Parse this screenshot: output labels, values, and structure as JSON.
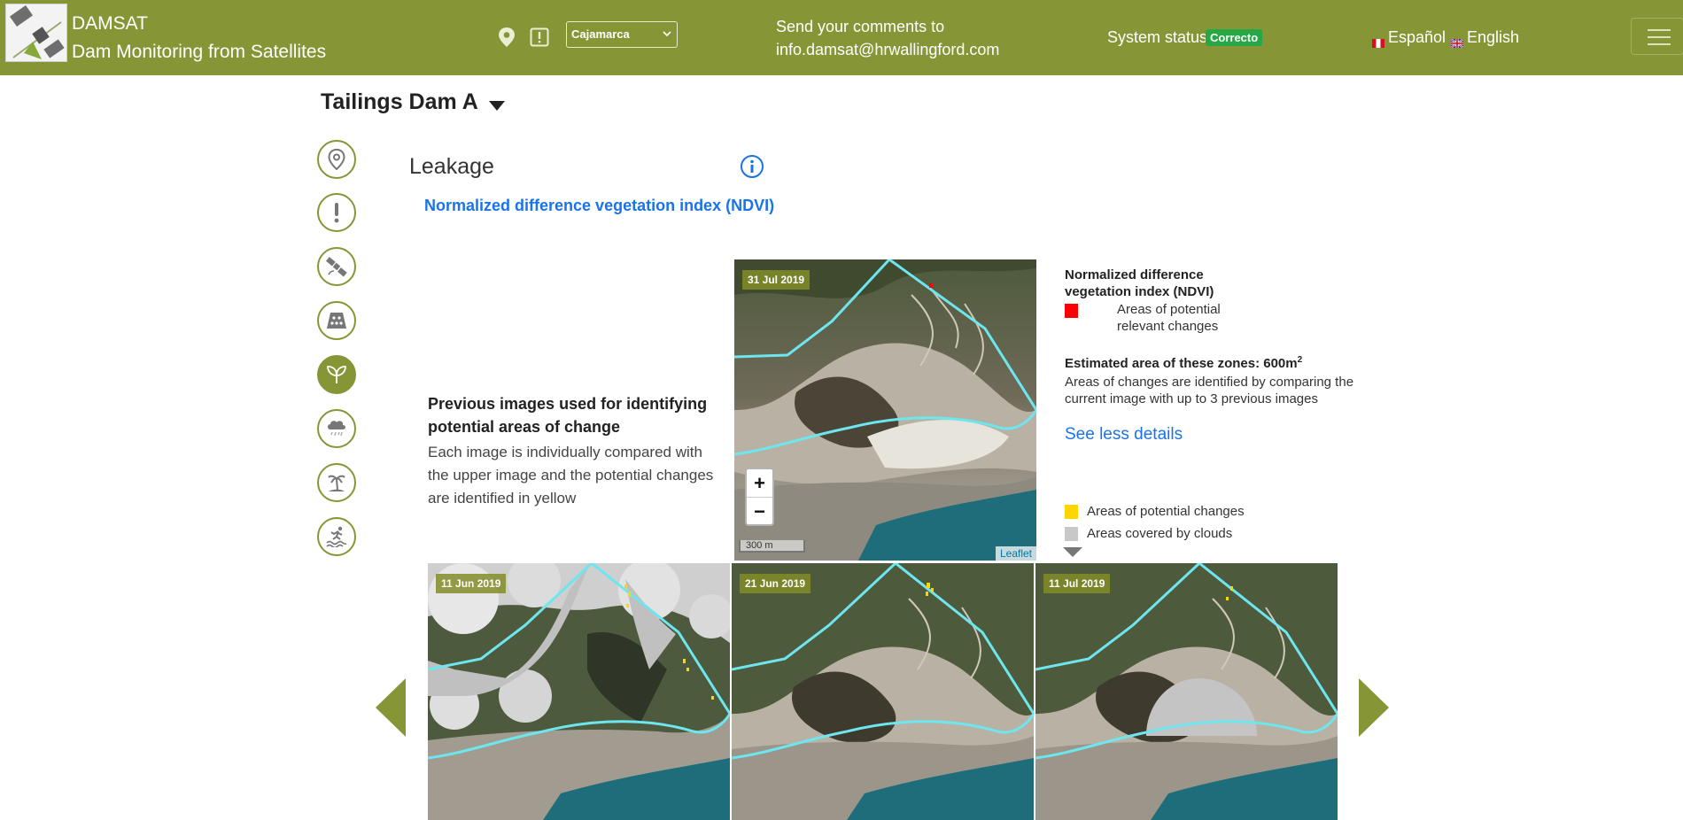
{
  "header": {
    "app_name": "DAMSAT",
    "app_subtitle": "Dam Monitoring from Satellites",
    "region": "Cajamarca",
    "comments_line1": "Send your comments to",
    "comments_email": "info.damsat@hrwallingford.com",
    "status_label": "System status",
    "status_value": "Correcto",
    "lang_es": "Español",
    "lang_en": "English"
  },
  "dam": {
    "title": "Tailings Dam A"
  },
  "sidebar": {
    "items": [
      {
        "icon": "location-pin-icon"
      },
      {
        "icon": "alert-icon"
      },
      {
        "icon": "satellite-icon"
      },
      {
        "icon": "dam-structure-icon"
      },
      {
        "icon": "leaf-icon",
        "active": true
      },
      {
        "icon": "rain-cloud-icon"
      },
      {
        "icon": "palm-tree-icon"
      },
      {
        "icon": "flood-runner-icon"
      }
    ]
  },
  "content": {
    "section_title": "Leakage",
    "index_link": "Normalized difference vegetation index (NDVI)",
    "prev_title": "Previous images used for identifying potential areas of change",
    "prev_desc": "Each image is individually compared with the upper image and the potential changes are identified in yellow",
    "main_map": {
      "date": "31 Jul 2019",
      "zoom_in": "+",
      "zoom_out": "−",
      "scale": "300 m",
      "attribution": "Leaflet"
    },
    "thumbnails": [
      {
        "date": "11 Jun 2019"
      },
      {
        "date": "21 Jun 2019"
      },
      {
        "date": "11 Jul 2019"
      }
    ]
  },
  "legend": {
    "title": "Normalized difference vegetation index (NDVI)",
    "red_label": "Areas of potential relevant changes",
    "est_area_label": "Estimated area of these zones: 600m",
    "est_area_sup": "2",
    "est_desc": "Areas of changes are identified by comparing the current image with up to 3 previous images",
    "see_less": "See less details",
    "yellow_label": "Areas of potential changes",
    "grey_label": "Areas covered by clouds"
  },
  "colors": {
    "brand": "#869636",
    "link": "#1a73e8",
    "status": "#28a745",
    "change_red": "#ff0000",
    "change_yellow": "#ffd600",
    "cloud_grey": "#c8c8c8"
  }
}
